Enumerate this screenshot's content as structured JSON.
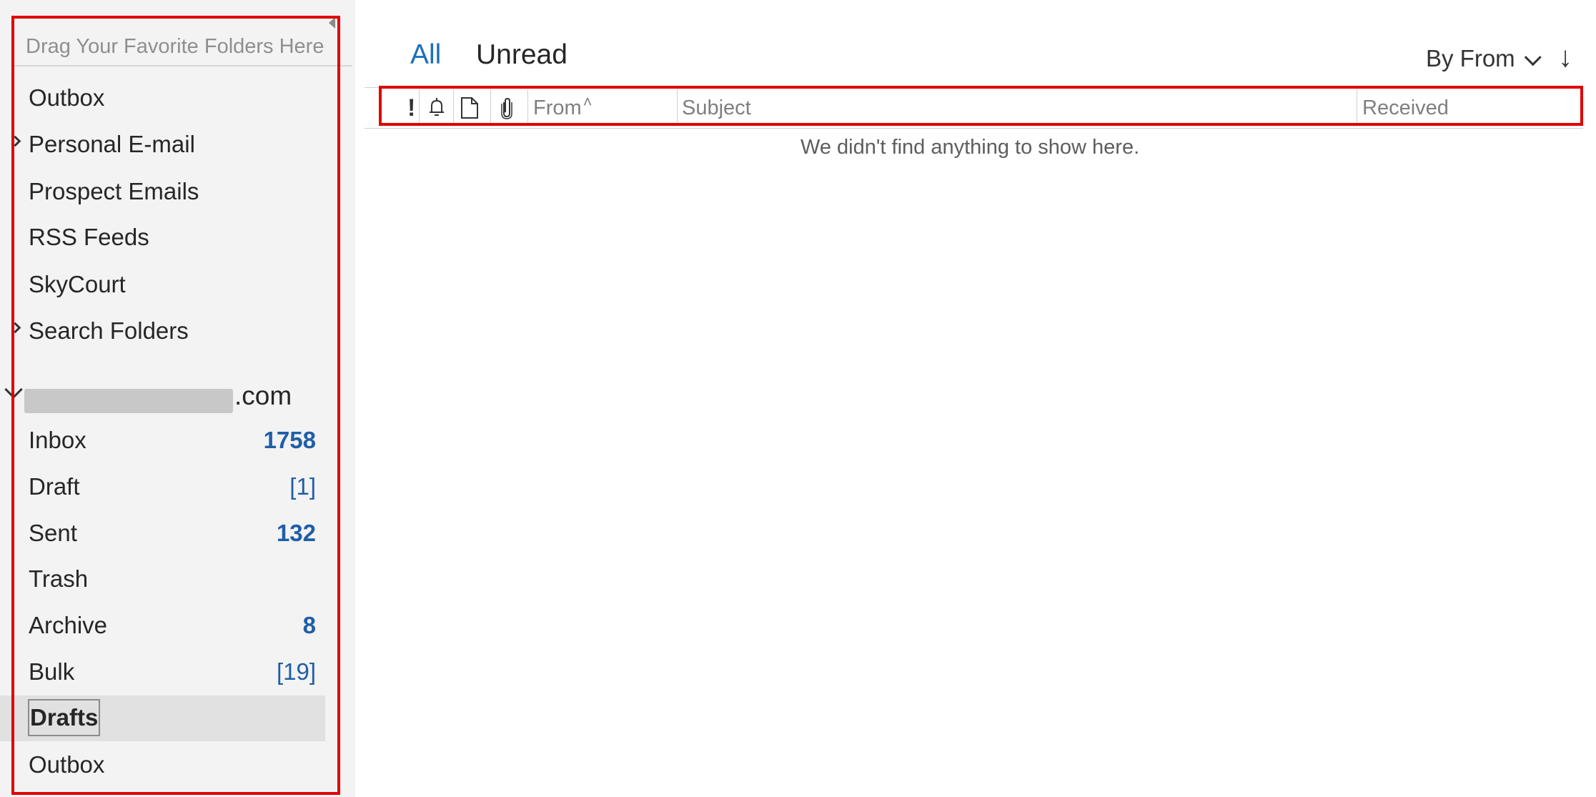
{
  "folder_pane": {
    "favorites_hint": "Drag Your Favorite Folders Here",
    "top_folders": [
      {
        "label": "Outbox",
        "expandable": false
      },
      {
        "label": "Personal E-mail",
        "expandable": true
      },
      {
        "label": "Prospect Emails",
        "expandable": false
      },
      {
        "label": "RSS Feeds",
        "expandable": false
      },
      {
        "label": "SkyCourt",
        "expandable": false
      },
      {
        "label": "Search Folders",
        "expandable": true
      }
    ],
    "account": {
      "label": ".com",
      "expanded": true
    },
    "account_folders": [
      {
        "label": "Inbox",
        "count": "1758",
        "count_style": "bold"
      },
      {
        "label": "Draft",
        "count": "[1]",
        "count_style": "bracket"
      },
      {
        "label": "Sent",
        "count": "132",
        "count_style": "bold"
      },
      {
        "label": "Trash",
        "count": "",
        "count_style": ""
      },
      {
        "label": "Archive",
        "count": "8",
        "count_style": "bold"
      },
      {
        "label": "Bulk",
        "count": "[19]",
        "count_style": "bracket"
      },
      {
        "label": "Drafts",
        "count": "",
        "count_style": "",
        "selected": true
      },
      {
        "label": "Outbox",
        "count": "",
        "count_style": ""
      }
    ]
  },
  "message_list": {
    "tabs": [
      {
        "label": "All",
        "active": true
      },
      {
        "label": "Unread",
        "active": false
      }
    ],
    "sort_by": "By From",
    "sort_direction_glyph": "↓",
    "columns": {
      "importance_glyph": "!",
      "from": "From",
      "from_sort_glyph": "˄",
      "subject": "Subject",
      "received": "Received"
    },
    "empty_message": "We didn't find anything to show here."
  },
  "colors": {
    "accent": "#1f6fbf",
    "count": "#1f5ea8",
    "highlight": "#e00000",
    "pane_bg": "#f3f3f3"
  }
}
